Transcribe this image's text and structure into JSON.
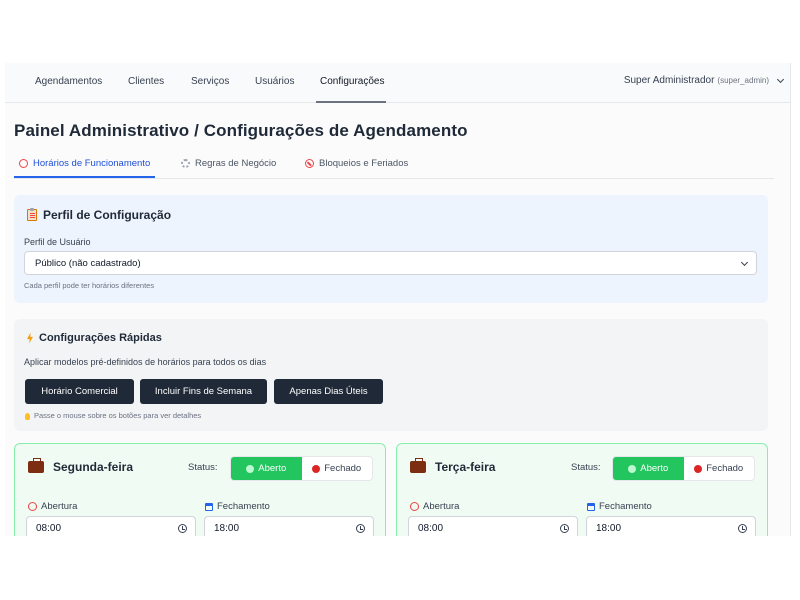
{
  "nav": {
    "items": [
      "Agendamentos",
      "Clientes",
      "Serviços",
      "Usuários",
      "Configurações"
    ],
    "active": "Configurações",
    "user_name": "Super Administrador",
    "user_role": "(super_admin)"
  },
  "page_title": "Painel Administrativo / Configurações de Agendamento",
  "tabs": [
    {
      "label": "Horários de Funcionamento",
      "icon": "alarm-clock-icon",
      "active": true
    },
    {
      "label": "Regras de Negócio",
      "icon": "gear-icon",
      "active": false
    },
    {
      "label": "Bloqueios e Feriados",
      "icon": "prohibited-icon",
      "active": false
    }
  ],
  "profile": {
    "title": "Perfil de Configuração",
    "field_label": "Perfil de Usuário",
    "selected": "Público (não cadastrado)",
    "hint": "Cada perfil pode ter horários diferentes"
  },
  "quick": {
    "title": "Configurações Rápidas",
    "description": "Aplicar modelos pré-definidos de horários para todos os dias",
    "buttons": [
      "Horário Comercial",
      "Incluir Fins de Semana",
      "Apenas Dias Úteis"
    ],
    "hint": "Passe o mouse sobre os botões para ver detalhes"
  },
  "days": [
    {
      "name": "Segunda-feira",
      "status_label": "Status:",
      "open_label": "Aberto",
      "closed_label": "Fechado",
      "status": "Aberto",
      "opening_label": "Abertura",
      "closing_label": "Fechamento",
      "opening": "08:00",
      "closing": "18:00"
    },
    {
      "name": "Terça-feira",
      "status_label": "Status:",
      "open_label": "Aberto",
      "closed_label": "Fechado",
      "status": "Aberto",
      "opening_label": "Abertura",
      "closing_label": "Fechamento",
      "opening": "08:00",
      "closing": "18:00"
    }
  ],
  "colors": {
    "accent": "#2563eb",
    "open": "#22c55e",
    "closed": "#dc2626",
    "dark_button": "#1f2937"
  }
}
